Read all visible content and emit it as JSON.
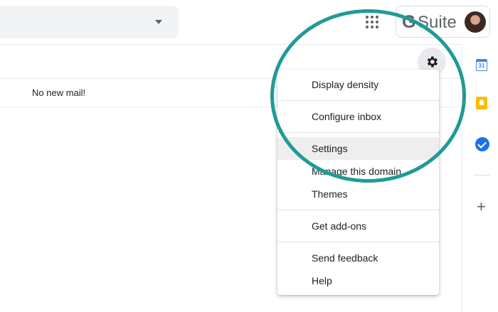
{
  "header": {
    "brand_g": "G",
    "brand_text": "Suite"
  },
  "inbox": {
    "empty_message": "No new mail!"
  },
  "sidebar": {
    "calendar_day": "31"
  },
  "settings_menu": {
    "items": [
      {
        "label": "Display density"
      },
      {
        "label": "Configure inbox"
      },
      {
        "label": "Settings",
        "highlighted": true
      },
      {
        "label": "Manage this domain"
      },
      {
        "label": "Themes"
      },
      {
        "label": "Get add-ons"
      },
      {
        "label": "Send feedback"
      },
      {
        "label": "Help"
      }
    ]
  },
  "icons": {
    "apps": "grid-apps-icon",
    "settings": "gear-icon",
    "calendar": "calendar-icon",
    "keep": "keep-icon",
    "tasks": "tasks-icon",
    "add": "plus-icon"
  },
  "colors": {
    "highlight_ring": "#1f9a99",
    "accent_blue": "#1a73e8",
    "keep_yellow": "#fbbc04"
  }
}
